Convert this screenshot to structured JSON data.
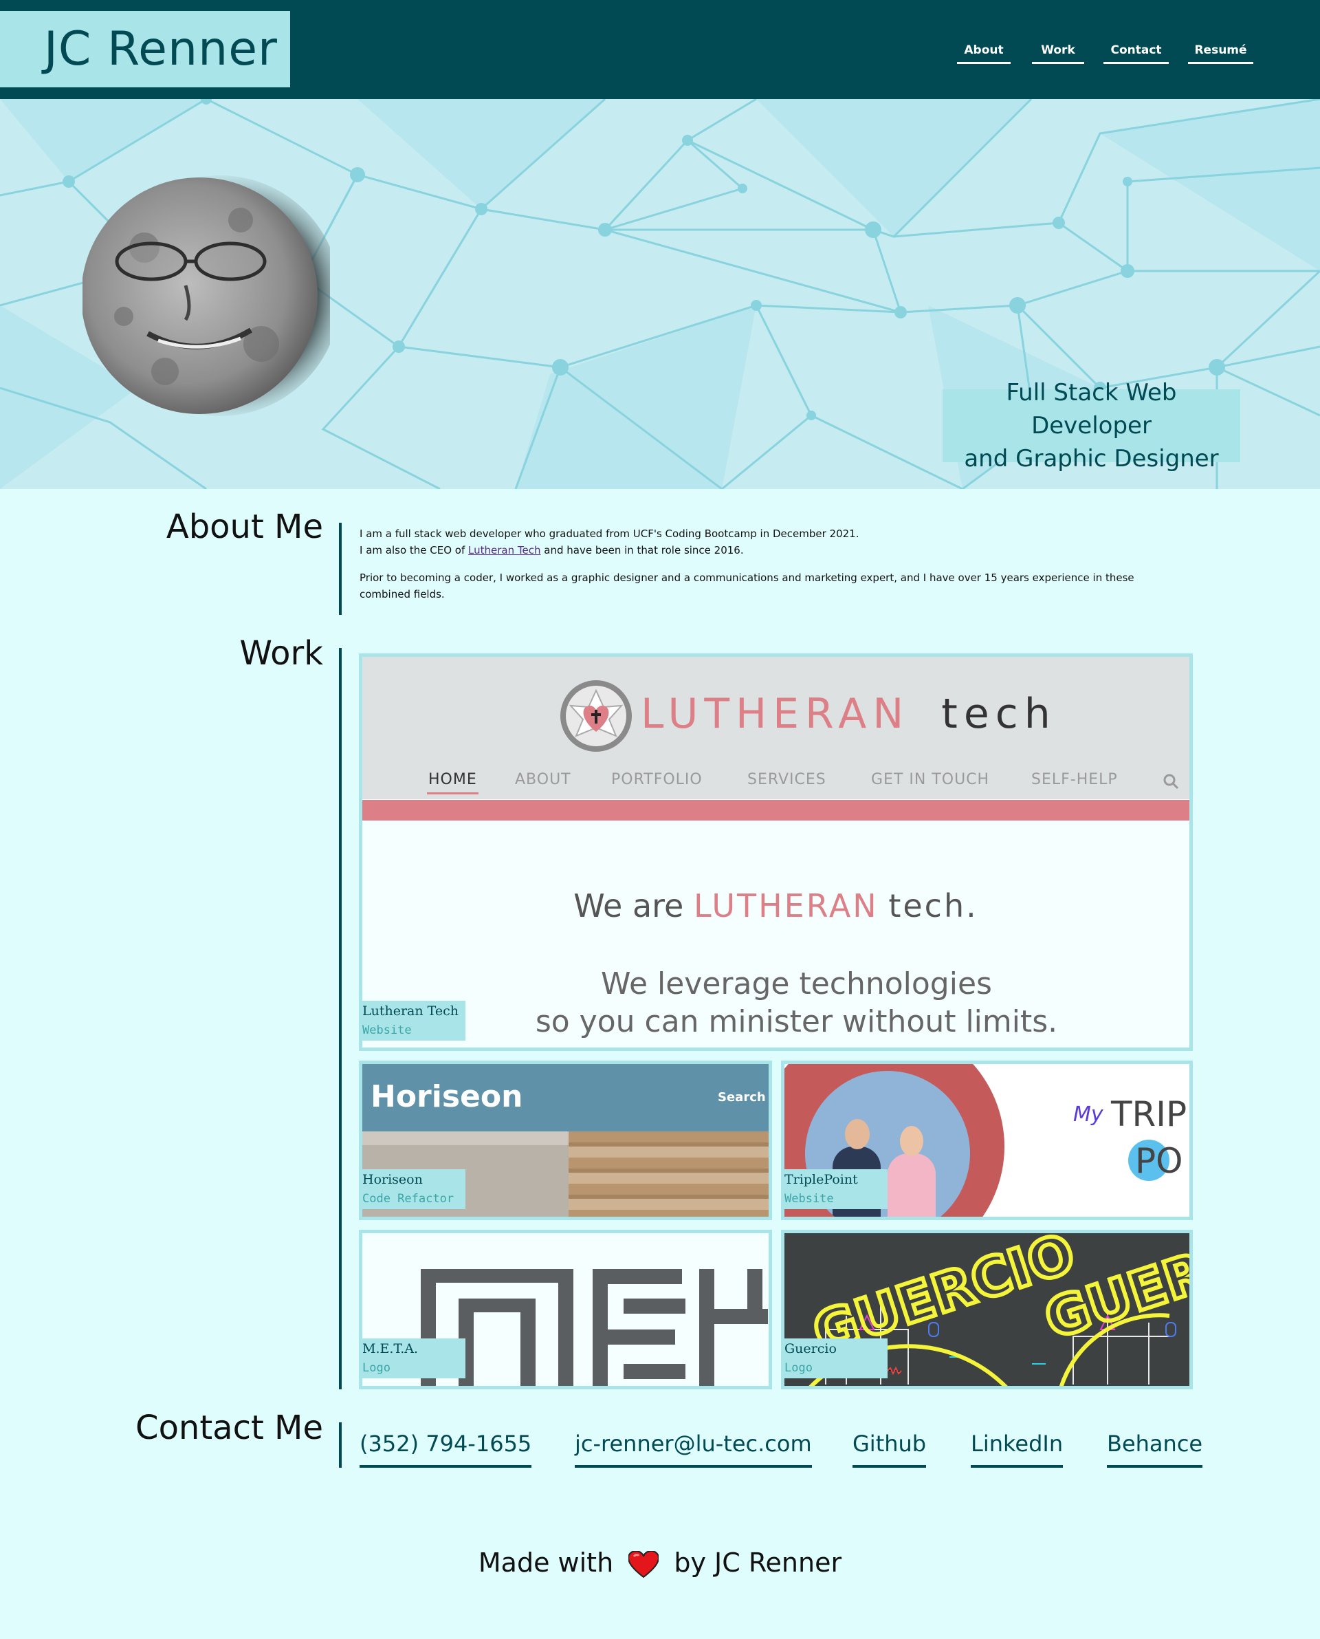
{
  "header": {
    "logo": "JC Renner",
    "nav": [
      "About",
      "Work",
      "Contact",
      "Resumé"
    ]
  },
  "hero": {
    "tagline_line1": "Full Stack Web Developer",
    "tagline_line2": "and Graphic Designer"
  },
  "about": {
    "title": "About Me",
    "p1_a": "I am a full stack web developer who graduated from UCF's Coding Bootcamp in December 2021.",
    "p1_b": "I am also the CEO of",
    "p1_link": "Lutheran Tech",
    "p1_c": "and have been in that role since 2016.",
    "p2": "Prior to becoming a coder, I worked as a graphic designer and a communications and marketing expert, and I have over 15 years experience in these combined fields."
  },
  "work": {
    "title": "Work",
    "lutheran_shot": {
      "brand_a": "LUTHERAN",
      "brand_b": "tech",
      "menu": [
        "HOME",
        "ABOUT",
        "PORTFOLIO",
        "SERVICES",
        "GET IN TOUCH",
        "SELF-HELP"
      ],
      "hero_a": "We are",
      "hero_b": "LUTHERAN",
      "hero_c": "tech.",
      "hero_line2": "We leverage technologies",
      "hero_line3": "so you can minister without limits."
    },
    "horiseon_shot": {
      "brand": "Horiseon",
      "search": "Search E"
    },
    "triplepoint_shot": {
      "my": "My",
      "trip": "TRIP",
      "po": "PO"
    },
    "guercio_shot": {
      "word": "GUERCIO",
      "word2": "GUER"
    },
    "projects": [
      {
        "title": "Lutheran Tech",
        "subtitle": "Website"
      },
      {
        "title": "Horiseon",
        "subtitle": "Code Refactor"
      },
      {
        "title": "TriplePoint",
        "subtitle": "Website"
      },
      {
        "title": "M.E.T.A.",
        "subtitle": "Logo"
      },
      {
        "title": "Guercio",
        "subtitle": "Logo"
      }
    ]
  },
  "contact": {
    "title": "Contact Me",
    "links": [
      "(352) 794-1655",
      "jc-renner@lu-tec.com",
      "Github",
      "LinkedIn",
      "Behance"
    ]
  },
  "footer": {
    "made_with": "Made with",
    "by": "by JC Renner",
    "heart_icon": "heart-icon"
  },
  "colors": {
    "header_bg": "#024a53",
    "accent": "#a8e4e8",
    "page_bg": "#e0fdfe",
    "lutheran_pink": "#dc7f86"
  }
}
